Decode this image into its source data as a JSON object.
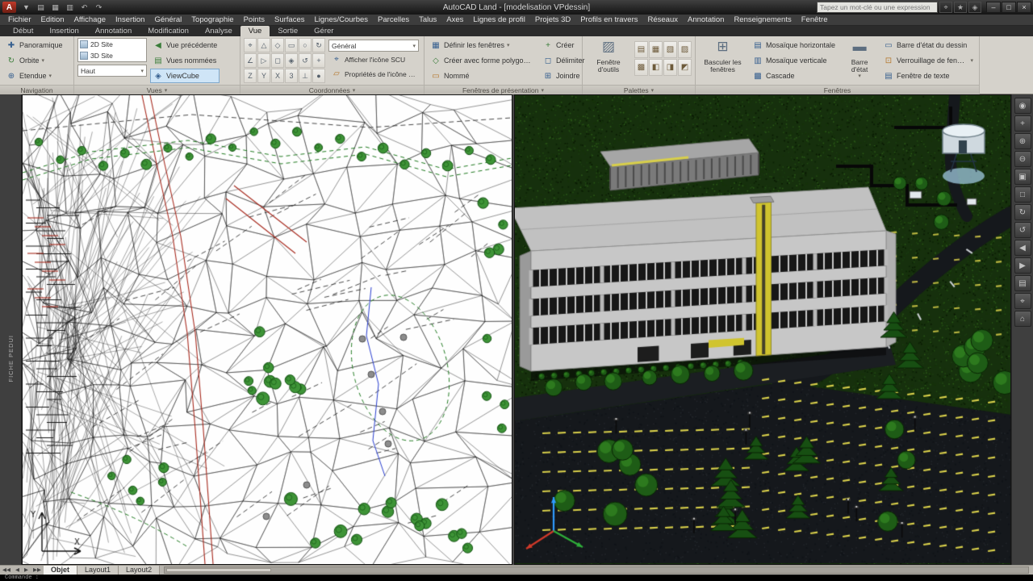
{
  "colors": {
    "titlebar_bg": "#1c1c1c",
    "menubar_bg": "#3d3d3d",
    "ribbon_bg": "#d5d2cb",
    "highlight_btn_bg": "#cfe5f7",
    "workspace_bg": "#454545",
    "viewport_left_bg": "#ffffff",
    "grass": "#16300d",
    "asphalt": "#15181c",
    "stripe_yellow": "#d8cf4a",
    "tree_green": "#1e5c16",
    "accent_red": "#a82a1e",
    "accent_green": "#1f7a1f",
    "accent_blue": "#2a3fd0"
  },
  "icons": {
    "dropdown": "▾",
    "app_logo": "A"
  },
  "titlebar": {
    "title": "AutoCAD Land - [modelisation VPdessin]",
    "search_placeholder": "Tapez un mot-clé ou une expression",
    "qat": [
      {
        "name": "app-menu-icon",
        "glyph": "▼"
      },
      {
        "name": "open-icon",
        "glyph": "▤"
      },
      {
        "name": "save-icon",
        "glyph": "▦"
      },
      {
        "name": "plot-icon",
        "glyph": "▥"
      },
      {
        "name": "undo-icon",
        "glyph": "↶"
      },
      {
        "name": "redo-icon",
        "glyph": "↷"
      }
    ],
    "info_icons": [
      {
        "name": "search-icon",
        "glyph": "⌖"
      },
      {
        "name": "favorites-icon",
        "glyph": "★"
      },
      {
        "name": "communication-center-icon",
        "glyph": "◈"
      }
    ],
    "window_buttons": [
      {
        "name": "minimize-button",
        "glyph": "–"
      },
      {
        "name": "restore-button",
        "glyph": "□"
      },
      {
        "name": "close-button",
        "glyph": "×"
      }
    ]
  },
  "menubar": {
    "items": [
      "Fichier",
      "Edition",
      "Affichage",
      "Insertion",
      "Général",
      "Topographie",
      "Points",
      "Surfaces",
      "Lignes/Courbes",
      "Parcelles",
      "Talus",
      "Axes",
      "Lignes de profil",
      "Projets 3D",
      "Profils en travers",
      "Réseaux",
      "Annotation",
      "Renseignements",
      "Fenêtre"
    ]
  },
  "ribbon_tabs": [
    {
      "label": "Début"
    },
    {
      "label": "Insertion"
    },
    {
      "label": "Annotation"
    },
    {
      "label": "Modification"
    },
    {
      "label": "Analyse"
    },
    {
      "label": "Vue",
      "active": true
    },
    {
      "label": "Sortie"
    },
    {
      "label": "Gérer"
    }
  ],
  "ribbon": {
    "navigation": {
      "caption": "Navigation",
      "pan": "Panoramique",
      "orbit": "Orbite",
      "extents": "Etendue"
    },
    "vues": {
      "caption": "Vues",
      "list": [
        "2D Site",
        "3D Site"
      ],
      "view_select": "Haut",
      "btn_prev": "Vue précédente",
      "btn_named": "Vues nommées",
      "btn_viewcube": "ViewCube"
    },
    "coordonnees": {
      "caption": "Coordonnées",
      "grid": [
        "⌖",
        "△",
        "◇",
        "▭",
        "○",
        "↻",
        "∠",
        "▷",
        "◻",
        "◈",
        "↺",
        "+",
        "Z",
        "Y",
        "X",
        "3",
        "⊥",
        "●"
      ],
      "select": "Général",
      "row1": "Afficher l'icône SCU",
      "row2": "Propriétés de l'icône SCU"
    },
    "fen_pres": {
      "caption": "Fenêtres de présentation",
      "row1": "Définir les fenêtres",
      "row2": "Créer avec forme polygonale",
      "row3": "Nommé",
      "btn1": "Créer",
      "btn2": "Délimiter",
      "btn3": "Joindre"
    },
    "palettes": {
      "caption": "Palettes",
      "main": "Fenêtre d'outils",
      "grid": [
        "▤",
        "▦",
        "▧",
        "▨",
        "▩",
        "◧",
        "◨",
        "◩"
      ]
    },
    "fenetres": {
      "caption": "Fenêtres",
      "big1": "Basculer les fenêtres",
      "rows": [
        "Mosaïque horizontale",
        "Mosaïque verticale",
        "Cascade"
      ],
      "big2": "Barre d'état",
      "right": [
        "Barre d'état du dessin",
        "Verrouillage de fenêtre",
        "Fenêtre de texte"
      ]
    }
  },
  "left_dock": {
    "label": "FICHE PEDUI"
  },
  "right_toolbar": {
    "icons": [
      {
        "name": "nav-wheel-icon",
        "glyph": "◉"
      },
      {
        "name": "pan-icon",
        "glyph": "+"
      },
      {
        "name": "zoom-in-icon",
        "glyph": "⊕"
      },
      {
        "name": "zoom-out-icon",
        "glyph": "⊖"
      },
      {
        "name": "zoom-window-icon",
        "glyph": "▣"
      },
      {
        "name": "zoom-extents-icon",
        "glyph": "□"
      },
      {
        "name": "orbit-icon",
        "glyph": "↻"
      },
      {
        "name": "free-orbit-icon",
        "glyph": "↺"
      },
      {
        "name": "previous-view-icon",
        "glyph": "◀"
      },
      {
        "name": "next-view-icon",
        "glyph": "▶"
      },
      {
        "name": "named-views-icon",
        "glyph": "▤"
      },
      {
        "name": "ucs-icon",
        "glyph": "⌖"
      },
      {
        "name": "walk-icon",
        "glyph": "⌂"
      }
    ]
  },
  "layout": {
    "arrows": [
      "◀◀",
      "◀",
      "▶",
      "▶▶"
    ],
    "tabs": [
      {
        "label": "Objet",
        "active": true
      },
      {
        "label": "Layout1"
      },
      {
        "label": "Layout2"
      }
    ]
  },
  "command_line": {
    "text": "Commande :"
  }
}
